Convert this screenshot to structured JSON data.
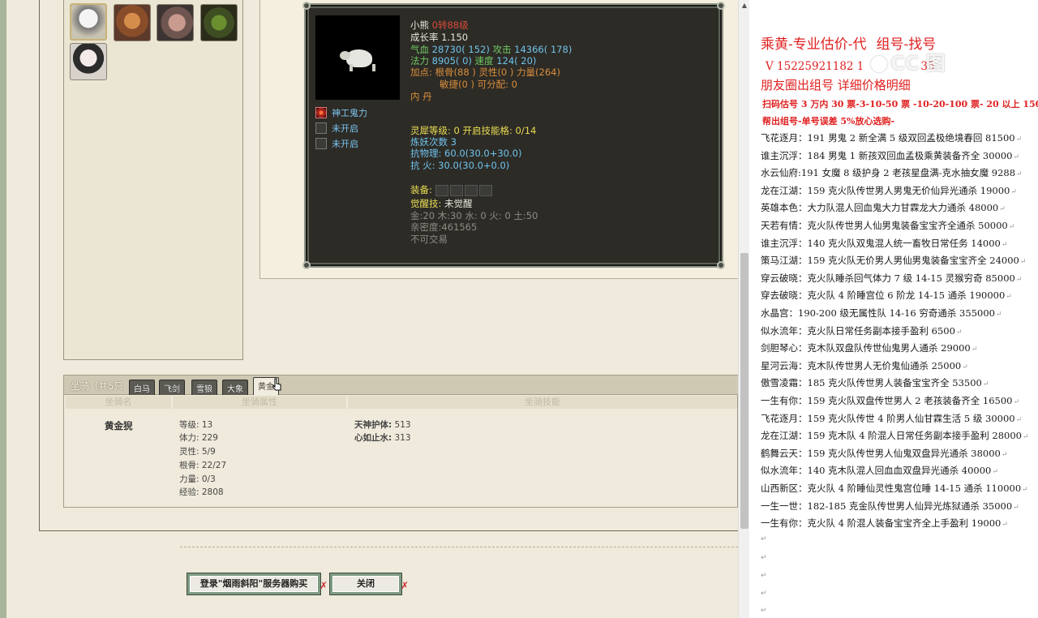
{
  "pet": {
    "name": "小熊",
    "level": "0转88级",
    "growth": "成长率 1.150",
    "hp_label": "气血",
    "hp_value": "28730( 152)",
    "atk_label": "攻击",
    "atk_value": "14366( 178)",
    "mp_label": "法力",
    "mp_value": "8905( 0)",
    "spd_label": "速度",
    "spd_value": "124( 20)",
    "points_line1": "加点:  根骨(88 ) 灵性(0 ) 力量(264)",
    "points_line2": "敏捷(0 ) 可分配:   0",
    "neidan": "内   丹",
    "skills": [
      {
        "label": "神工鬼力",
        "active": true
      },
      {
        "label": "未开启",
        "active": false
      },
      {
        "label": "未开启",
        "active": false
      }
    ],
    "soul_line": "灵犀等级:  0 开启技能格:  0/14",
    "refine_line": "炼妖次数 3",
    "resist_phys": "抗物理: 60.0(30.0+30.0)",
    "resist_fire": "抗   火: 30.0(30.0+0.0)",
    "equip_label": "装备:",
    "awaken_label": "觉醒技:",
    "awaken_value": "未觉醒",
    "elements": "金:20 木:30 水: 0 火: 0 土:50",
    "intimacy": "亲密度:461565",
    "untradable": "不可交易"
  },
  "mount": {
    "title": "坐骑（共5只",
    "tabs": [
      "白马",
      "飞剑",
      "雪狼",
      "大象",
      "黄金"
    ],
    "active_tab": 4,
    "col_name": "坐骑名",
    "col_attr": "坐骑属性",
    "col_skill": "坐骑技能",
    "name": "黄金猊",
    "attrs": [
      "等级: 13",
      "体力: 229",
      "灵性: 5/9",
      "根骨: 22/27",
      "力量: 0/3",
      "经验: 2808"
    ],
    "skill1_name": "天神护体:",
    "skill1_value": "513",
    "skill2_name": "心如止水:",
    "skill2_value": "313"
  },
  "buttons": {
    "login": "登录\"烟雨斜阳\"服务器购买",
    "close": "关闭"
  },
  "doc": {
    "heading": "乘黄-专业估价-代",
    "heading_tail": "组号-找号",
    "phone": "V 15225921182   1",
    "phone_tail": "35",
    "watermark": "CC 图",
    "line3": "朋友圈出组号     详细价格明细",
    "line4": "扫码估号 3 万内 30 票-3-10-50 票  -10-20-100 票- 20 以上 150",
    "line5": "帮出组号-单号误差 5%放心选购-",
    "listings": [
      "飞花逐月：191 男鬼 2 新全满 5 级双回孟极绝境春回 81500",
      "谁主沉浮：184 男鬼 1 新孩双回血孟极乘黄装备齐全 30000",
      "水云仙府:191 女魔 8 级护身 2 老孩星盘满-克水抽女魔 9288",
      "龙在江湖：159 克火队传世男人男鬼无价仙异光通杀 19000",
      "英雄本色：大力队混人回血鬼大力甘霖龙大力通杀 48000",
      "天若有情：克火队传世男人仙男鬼装备宝宝齐全通杀 50000",
      "谁主沉浮：140 克火队双鬼混人统一畜牧日常任务 14000",
      "策马江湖：159 克火队无价男人男仙男鬼装备宝宝齐全 24000",
      "穿云破晓：克火队睡杀回气体力 7 级 14-15 灵猴穷奇 85000",
      "穿去破晓：克火队 4 阶睡宫位 6 阶龙 14-15 通杀 190000",
      "水晶宫：190-200 级无属性队 14-16 穷奇通杀 355000",
      "似水流年：克火队日常任务副本接手盈利 6500",
      "剑胆琴心：克木队双盘队传世仙鬼男人通杀 29000",
      "星河云海：克木队传世男人无价鬼仙通杀 25000",
      "傲雪凌霜：185 克火队传世男人装备宝宝齐全 53500",
      "一生有你：159 克火队双盘传世男人 2 老孩装备齐全 16500",
      "飞花逐月：159 克火队传世 4 阶男人仙甘霖生活 5 级 30000",
      "龙在江湖：159 克木队 4 阶混人日常任务副本接手盈利 28000",
      "鹤舞云天：159 克火队传世男人仙鬼双盘异光通杀 38000",
      "似水流年：140 克木队混人回血血双盘异光通杀 40000",
      "山西新区：克火队 4 阶睡仙灵性鬼宫位睡 14-15 通杀 110000",
      "一生一世：182-185 克金队传世男人仙异光炼狱通杀 35000",
      "一生有你：克火队 4 阶混人装备宝宝齐全上手盈利 19000"
    ]
  }
}
